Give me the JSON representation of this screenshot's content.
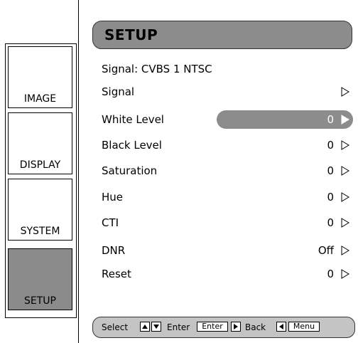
{
  "tabs": [
    {
      "label": "IMAGE",
      "active": false
    },
    {
      "label": "DISPLAY",
      "active": false
    },
    {
      "label": "SYSTEM",
      "active": false
    },
    {
      "label": "SETUP",
      "active": true
    }
  ],
  "menu": {
    "title": "SETUP",
    "signal_info": "Signal: CVBS 1 NTSC",
    "items": [
      {
        "label": "Signal",
        "value": ""
      },
      {
        "label": "White Level",
        "value": "0",
        "selected": true
      },
      {
        "label": "Black Level",
        "value": "0"
      },
      {
        "label": "Saturation",
        "value": "0"
      },
      {
        "label": "Hue",
        "value": "0"
      },
      {
        "label": "CTI",
        "value": "0"
      },
      {
        "label": "DNR",
        "value": "Off"
      },
      {
        "label": "Reset",
        "value": "0"
      }
    ]
  },
  "footer": {
    "select_label": "Select",
    "enter_label": "Enter",
    "enter_key": "Enter",
    "back_label": "Back",
    "menu_key": "Menu"
  },
  "colors": {
    "highlight": "#8c8c8c",
    "footer_bg": "#c4c4c4"
  },
  "icons": [
    "right-arrow-icon",
    "up-key-icon",
    "down-key-icon",
    "right-key-icon",
    "left-key-icon"
  ]
}
